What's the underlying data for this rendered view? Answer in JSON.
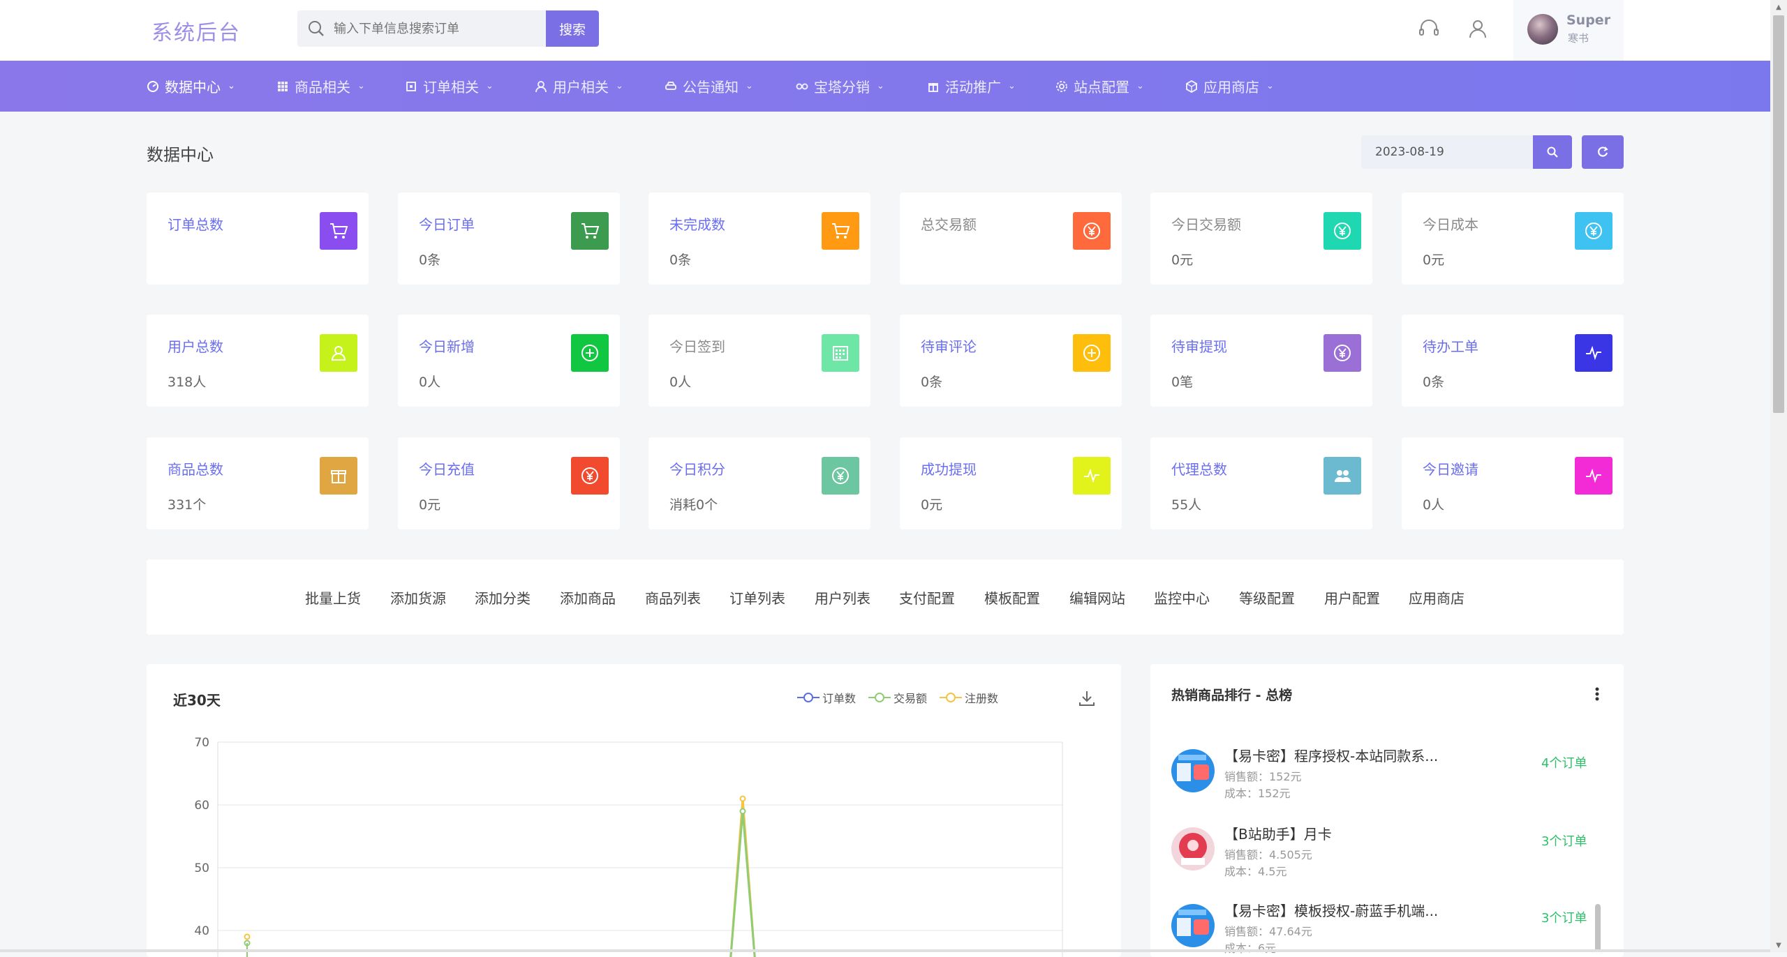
{
  "header": {
    "logo": "系统后台",
    "search_placeholder": "输入下单信息搜索订单",
    "search_button": "搜索",
    "user_name": "Super",
    "user_sub": "寒书"
  },
  "nav": [
    {
      "label": "数据中心",
      "icon": "dashboard-icon"
    },
    {
      "label": "商品相关",
      "icon": "grid-icon"
    },
    {
      "label": "订单相关",
      "icon": "order-icon"
    },
    {
      "label": "用户相关",
      "icon": "user-icon"
    },
    {
      "label": "公告通知",
      "icon": "car-icon"
    },
    {
      "label": "宝塔分销",
      "icon": "link-icon"
    },
    {
      "label": "活动推广",
      "icon": "gift-icon"
    },
    {
      "label": "站点配置",
      "icon": "gear-icon"
    },
    {
      "label": "应用商店",
      "icon": "box-icon"
    }
  ],
  "page": {
    "title": "数据中心",
    "date": "2023-08-19"
  },
  "cards": [
    {
      "label": "订单总数",
      "value": "",
      "color": "#8a4df0",
      "icon": "cart-icon",
      "muted": false
    },
    {
      "label": "今日订单",
      "value": "0条",
      "color": "#3c9b4e",
      "icon": "cart-icon",
      "muted": false
    },
    {
      "label": "未完成数",
      "value": "0条",
      "color": "#ff9a12",
      "icon": "cart-icon",
      "muted": false
    },
    {
      "label": "总交易额",
      "value": "",
      "color": "#ff6a3c",
      "icon": "yen-icon",
      "muted": true
    },
    {
      "label": "今日交易额",
      "value": "0元",
      "color": "#1fd7b0",
      "icon": "yen-icon",
      "muted": true
    },
    {
      "label": "今日成本",
      "value": "0元",
      "color": "#3ec2f2",
      "icon": "yen-icon",
      "muted": true
    },
    {
      "label": "用户总数",
      "value": "318人",
      "color": "#c6f21b",
      "icon": "user-icon",
      "muted": false
    },
    {
      "label": "今日新增",
      "value": "0人",
      "color": "#11c640",
      "icon": "plus-icon",
      "muted": false
    },
    {
      "label": "今日签到",
      "value": "0人",
      "color": "#6ee6a6",
      "icon": "calendar-icon",
      "muted": true
    },
    {
      "label": "待审评论",
      "value": "0条",
      "color": "#ffbe0b",
      "icon": "plus-icon",
      "muted": false
    },
    {
      "label": "待审提现",
      "value": "0笔",
      "color": "#9a6fd6",
      "icon": "yen-icon",
      "muted": false
    },
    {
      "label": "待办工单",
      "value": "0条",
      "color": "#3a36e6",
      "icon": "pulse-icon",
      "muted": false
    },
    {
      "label": "商品总数",
      "value": "331个",
      "color": "#dfa641",
      "icon": "gift-icon",
      "muted": false
    },
    {
      "label": "今日充值",
      "value": "0元",
      "color": "#f24a2e",
      "icon": "yen-icon",
      "muted": false
    },
    {
      "label": "今日积分",
      "value": "消耗0个",
      "color": "#6cc6a0",
      "icon": "yen-icon",
      "muted": false
    },
    {
      "label": "成功提现",
      "value": "0元",
      "color": "#e2f21b",
      "icon": "pulse-icon",
      "muted": false
    },
    {
      "label": "代理总数",
      "value": "55人",
      "color": "#6bbad0",
      "icon": "users-icon",
      "muted": false
    },
    {
      "label": "今日邀请",
      "value": "0人",
      "color": "#f22bd6",
      "icon": "pulse-icon",
      "muted": false
    }
  ],
  "quick_links": [
    "批量上货",
    "添加货源",
    "添加分类",
    "添加商品",
    "商品列表",
    "订单列表",
    "用户列表",
    "支付配置",
    "模板配置",
    "编辑网站",
    "监控中心",
    "等级配置",
    "用户配置",
    "应用商店"
  ],
  "chart_panel": {
    "title": "近30天"
  },
  "chart_data": {
    "type": "line",
    "series": [
      {
        "name": "订单数",
        "color": "#5b6ee1"
      },
      {
        "name": "交易额",
        "color": "#91cc75"
      },
      {
        "name": "注册数",
        "color": "#f4c542"
      }
    ],
    "y_ticks": [
      "70",
      "60",
      "50",
      "40"
    ],
    "ylim_visible": [
      35,
      70
    ],
    "visible_points": [
      {
        "series": "注册数",
        "position": "first",
        "y": 39
      },
      {
        "series": "交易额",
        "position": "first",
        "y": 38
      },
      {
        "series": "注册数",
        "position": "peak",
        "y": 61
      },
      {
        "series": "交易额",
        "position": "peak",
        "y": 59
      }
    ]
  },
  "ranking": {
    "title": "热销商品排行 - 总榜",
    "items": [
      {
        "name": "【易卡密】程序授权-本站同款系...",
        "sales": "销售额：152元",
        "cost": "成本：152元",
        "orders": "4个订单"
      },
      {
        "name": "【B站助手】月卡",
        "sales": "销售额：4.505元",
        "cost": "成本：4.5元",
        "orders": "3个订单"
      },
      {
        "name": "【易卡密】模板授权-蔚蓝手机端...",
        "sales": "销售额：47.64元",
        "cost": "成本：6元",
        "orders": "3个订单"
      }
    ]
  }
}
